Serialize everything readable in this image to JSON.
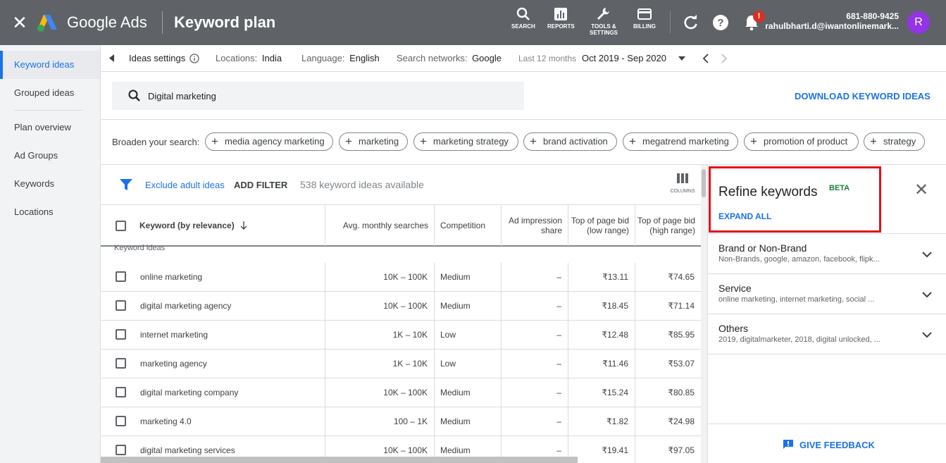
{
  "topbar": {
    "brand": "Google Ads",
    "page_title": "Keyword plan",
    "tools": [
      {
        "label": "SEARCH",
        "icon": "search-icon"
      },
      {
        "label": "REPORTS",
        "icon": "bar-chart-icon"
      },
      {
        "label": "TOOLS & SETTINGS",
        "icon": "wrench-icon"
      },
      {
        "label": "BILLING",
        "icon": "credit-card-icon"
      }
    ],
    "notification_badge": "!",
    "account_phone": "681-880-9425",
    "account_email": "rahulbharti.d@iwantonlinemark...",
    "avatar_letter": "R",
    "colors": {
      "bar": "#5f6368",
      "avatar": "#9334e6",
      "badge": "#d93025"
    }
  },
  "sidebar": {
    "items": [
      {
        "label": "Keyword ideas",
        "active": true
      },
      {
        "label": "Grouped ideas"
      },
      {
        "label": "Plan overview"
      },
      {
        "label": "Ad Groups"
      },
      {
        "label": "Keywords"
      },
      {
        "label": "Locations"
      }
    ]
  },
  "settings": {
    "ideas_settings": "Ideas settings",
    "locations_label": "Locations:",
    "locations_value": "India",
    "language_label": "Language:",
    "language_value": "English",
    "networks_label": "Search networks:",
    "networks_value": "Google",
    "period_label": "Last 12 months",
    "period_value": "Oct 2019 - Sep 2020"
  },
  "search": {
    "query": "Digital marketing",
    "download_label": "DOWNLOAD KEYWORD IDEAS"
  },
  "broaden": {
    "label": "Broaden your search:",
    "chips": [
      "media agency marketing",
      "marketing",
      "marketing strategy",
      "brand activation",
      "megatrend marketing",
      "promotion of product",
      "strategy"
    ]
  },
  "filters": {
    "exclude_adult": "Exclude adult ideas",
    "add_filter": "ADD FILTER",
    "count_text": "538 keyword ideas available",
    "columns_label": "COLUMNS"
  },
  "table": {
    "headers": {
      "keyword": "Keyword (by relevance)",
      "avg": "Avg. monthly searches",
      "competition": "Competition",
      "impression": "Ad impression share",
      "bid_low": "Top of page bid (low range)",
      "bid_high": "Top of page bid (high range)"
    },
    "group_label": "Keyword ideas",
    "rows": [
      {
        "keyword": "online marketing",
        "avg": "10K – 100K",
        "competition": "Medium",
        "impression": "–",
        "low": "₹13.11",
        "high": "₹74.65"
      },
      {
        "keyword": "digital marketing agency",
        "avg": "10K – 100K",
        "competition": "Medium",
        "impression": "–",
        "low": "₹18.45",
        "high": "₹71.14"
      },
      {
        "keyword": "internet marketing",
        "avg": "1K – 10K",
        "competition": "Low",
        "impression": "–",
        "low": "₹12.48",
        "high": "₹85.95"
      },
      {
        "keyword": "marketing agency",
        "avg": "1K – 10K",
        "competition": "Low",
        "impression": "–",
        "low": "₹11.46",
        "high": "₹53.07"
      },
      {
        "keyword": "digital marketing company",
        "avg": "10K – 100K",
        "competition": "Medium",
        "impression": "–",
        "low": "₹15.24",
        "high": "₹80.85"
      },
      {
        "keyword": "marketing 4.0",
        "avg": "100 – 1K",
        "competition": "Medium",
        "impression": "–",
        "low": "₹1.82",
        "high": "₹24.98"
      },
      {
        "keyword": "digital marketing services",
        "avg": "10K – 100K",
        "competition": "Medium",
        "impression": "–",
        "low": "₹19.41",
        "high": "₹97.05"
      }
    ]
  },
  "refine": {
    "title": "Refine keywords",
    "beta": "BETA",
    "expand_all": "EXPAND ALL",
    "groups": [
      {
        "name": "Brand or Non-Brand",
        "sub": "Non-Brands, google, amazon, facebook, flipk..."
      },
      {
        "name": "Service",
        "sub": "online marketing, internet marketing, social ..."
      },
      {
        "name": "Others",
        "sub": "2019, digitalmarketer, 2018, digital unlocked, ..."
      }
    ],
    "feedback": "GIVE FEEDBACK",
    "highlight_color": "#e3101a"
  }
}
